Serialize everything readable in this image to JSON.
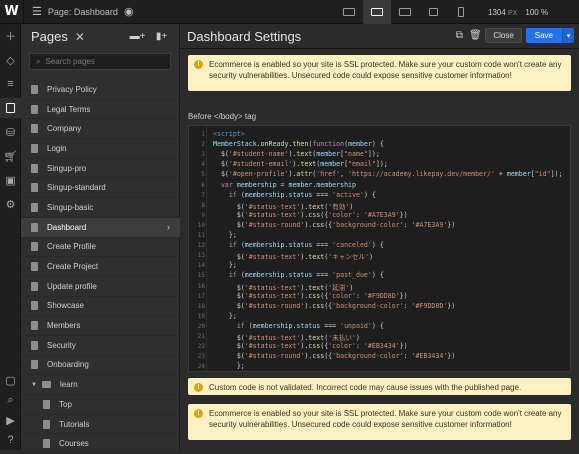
{
  "topbar": {
    "logo": "W",
    "page_label": "Page: Dashboard",
    "width": "1304",
    "width_unit": "PX",
    "zoom": "100 %"
  },
  "pages_panel": {
    "title": "Pages",
    "search_placeholder": "Search pages",
    "items": [
      {
        "label": "Privacy Policy",
        "kind": "page"
      },
      {
        "label": "Legal Terms",
        "kind": "page"
      },
      {
        "label": "Company",
        "kind": "page"
      },
      {
        "label": "Login",
        "kind": "page"
      },
      {
        "label": "Singup-pro",
        "kind": "page"
      },
      {
        "label": "Singup-standard",
        "kind": "page"
      },
      {
        "label": "Singup-basic",
        "kind": "page"
      },
      {
        "label": "Dashboard",
        "kind": "page",
        "active": true
      },
      {
        "label": "Create Profile",
        "kind": "page"
      },
      {
        "label": "Create Project",
        "kind": "page"
      },
      {
        "label": "Update profile",
        "kind": "page"
      },
      {
        "label": "Showcase",
        "kind": "page"
      },
      {
        "label": "Members",
        "kind": "page"
      },
      {
        "label": "Security",
        "kind": "page"
      },
      {
        "label": "Onboarding",
        "kind": "page"
      },
      {
        "label": "learn",
        "kind": "folder"
      },
      {
        "label": "Top",
        "kind": "child"
      },
      {
        "label": "Tutorials",
        "kind": "child"
      },
      {
        "label": "Courses",
        "kind": "child"
      }
    ]
  },
  "settings": {
    "title": "Dashboard Settings",
    "close_label": "Close",
    "save_label": "Save",
    "ssl_notice": "Ecommerce is enabled so your site is SSL protected. Make sure your custom code won't create any security vulnerabilities. Unsecured code could expose sensitive customer information!",
    "code_label": "Before </body> tag",
    "validation_notice": "Custom code is not validated. Incorrect code may cause issues with the published page.",
    "ssl_notice_2": "Ecommerce is enabled so your site is SSL protected. Make sure your custom code won't create any security vulnerabilities. Unsecured code could expose sensitive customer information!"
  },
  "code": {
    "line_numbers": [
      "1",
      "2",
      "3",
      "4",
      "5",
      "6",
      "7",
      "8",
      "9",
      "10",
      "11",
      "12",
      "13",
      "14",
      "15",
      "16",
      "17",
      "18",
      "19",
      "20",
      "21",
      "22",
      "23",
      "24"
    ],
    "lines": [
      "<script>",
      "MemberStack.onReady.then(function(member) {",
      "  $('#student-name').text(member[\"name\"]);",
      "  $('#student-email').text(member[\"email\"]);",
      "  $('#open-profile').attr('href', 'https://academy.likepay.dev/member/' + member[\"id\"]);",
      "  var membership = member.membership",
      "    if (membership.status === 'active') {",
      "      $('#status-text').text('有効')",
      "      $('#status-text').css({'color': '#A7E3A9'})",
      "      $('#status-round').css({'background-color': '#A7E3A9'})",
      "    };",
      "    if (membership.status === 'canceled') {",
      "      $('#status-text').text('キャンセル')",
      "    };",
      "    if (membership.status === 'past_due') {",
      "      $('#status-text').text('延滞')",
      "      $('#status-text').css({'color': '#F9DD8D'})",
      "      $('#status-round').css({'background-color': '#F9DD8D'})",
      "    };",
      "      if (membership.status === 'unpaid') {",
      "      $('#status-text').text('未払い')",
      "      $('#status-text').css({'color': '#EB3434'})",
      "      $('#status-round').css({'background-color': '#EB3434'})",
      "      };"
    ]
  },
  "colors": {
    "accent": "#2274e8",
    "warning_bg": "#fdf1c4",
    "warning_icon": "#d8a40f"
  }
}
